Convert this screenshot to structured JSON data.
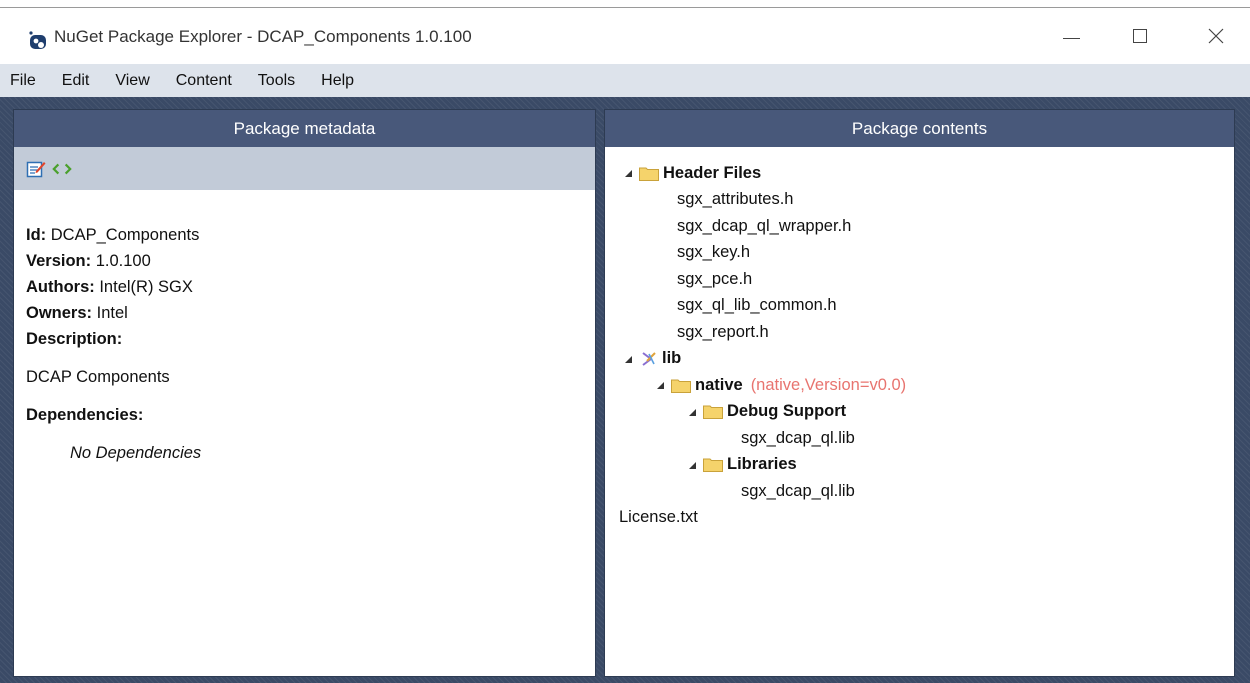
{
  "window": {
    "title": "NuGet Package Explorer - DCAP_Components 1.0.100",
    "min_label": "—",
    "close_label": "✕"
  },
  "menu": [
    "File",
    "Edit",
    "View",
    "Content",
    "Tools",
    "Help"
  ],
  "metadata_panel": {
    "header": "Package metadata",
    "toolbar": [
      {
        "icon": "edit-metadata-icon"
      },
      {
        "icon": "view-xml-icon"
      }
    ],
    "fields": [
      {
        "label": "Id:",
        "value": "DCAP_Components"
      },
      {
        "label": "Version:",
        "value": "1.0.100"
      },
      {
        "label": "Authors:",
        "value": "Intel(R) SGX"
      },
      {
        "label": "Owners:",
        "value": "Intel"
      }
    ],
    "description_label": "Description:",
    "description": "DCAP Components",
    "dependencies_label": "Dependencies:",
    "no_dependencies": "No Dependencies"
  },
  "contents_panel": {
    "header": "Package contents",
    "tree": {
      "header_files": {
        "label": "Header Files",
        "files": [
          "sgx_attributes.h",
          "sgx_dcap_ql_wrapper.h",
          "sgx_key.h",
          "sgx_pce.h",
          "sgx_ql_lib_common.h",
          "sgx_report.h"
        ]
      },
      "lib": {
        "label": "lib",
        "native": {
          "label": "native",
          "framework": "(native,Version=v0.0)",
          "debug_support": {
            "label": "Debug Support",
            "files": [
              "sgx_dcap_ql.lib"
            ]
          },
          "libraries": {
            "label": "Libraries",
            "files": [
              "sgx_dcap_ql.lib"
            ]
          }
        }
      },
      "root_files": [
        "License.txt"
      ]
    }
  },
  "colors": {
    "workspace": "#3a4a66",
    "panel_header": "#48587a",
    "toolbar": "#c2cbd8",
    "menubar": "#dde3eb",
    "framework_tag": "#e8746f",
    "folder": "#f5d36b"
  }
}
